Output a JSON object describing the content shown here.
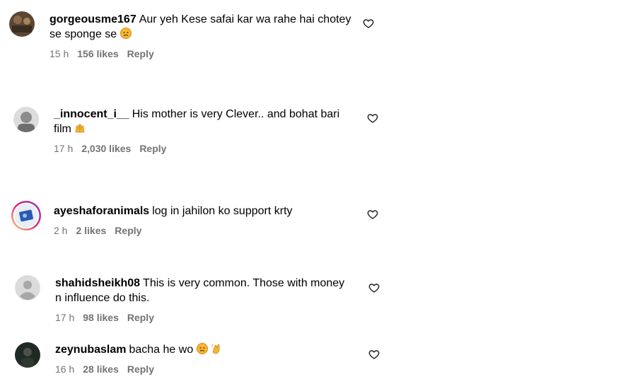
{
  "comments": [
    {
      "username": "gorgeousme167",
      "text": "Aur yeh Kese safai kar wa rahe hai chotey se sponge se",
      "emoji": [
        "sad-face"
      ],
      "time": "15 h",
      "likes": "156 likes",
      "reply": "Reply",
      "avatar": "photo"
    },
    {
      "username": "_innocent_i__",
      "text": "His mother is very Clever.. and bohat bari film",
      "emoji": [
        "raised-hands"
      ],
      "time": "17 h",
      "likes": "2,030 likes",
      "reply": "Reply",
      "avatar": "photo"
    },
    {
      "username": "ayeshaforanimals",
      "text": "log in jahilon ko support krty",
      "emoji": [],
      "time": "2 h",
      "likes": "2 likes",
      "reply": "Reply",
      "avatar": "story-ring"
    },
    {
      "username": "shahidsheikh08",
      "text": "This is very common. Those with money n influence do this.",
      "emoji": [],
      "time": "17 h",
      "likes": "98 likes",
      "reply": "Reply",
      "avatar": "default"
    },
    {
      "username": "zeynubaslam",
      "text": "bacha he wo",
      "emoji": [
        "sad-face",
        "clap"
      ],
      "time": "16 h",
      "likes": "28 likes",
      "reply": "Reply",
      "avatar": "photo"
    }
  ],
  "colors": {
    "meta": "#737373",
    "story_ring_a": "#d62976",
    "story_ring_b": "#feda75"
  }
}
